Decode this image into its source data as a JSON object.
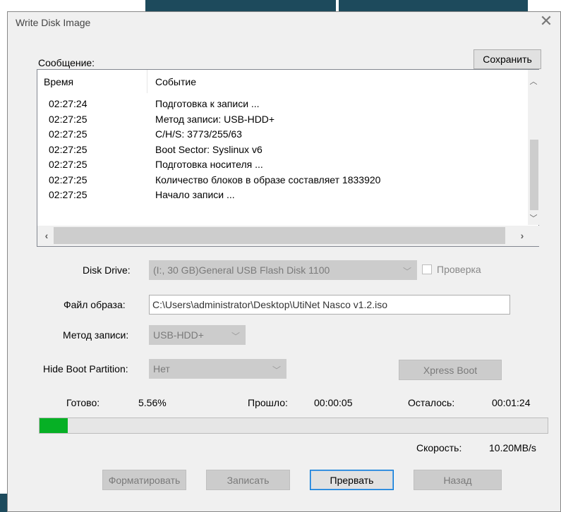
{
  "window": {
    "title": "Write Disk Image",
    "close_glyph": "✕"
  },
  "log": {
    "label": "Сообщение:",
    "save_label": "Сохранить",
    "columns": [
      "Время",
      "Событие"
    ],
    "rows": [
      {
        "time": "02:27:24",
        "event": "Подготовка к записи ..."
      },
      {
        "time": "02:27:25",
        "event": "Метод записи: USB-HDD+"
      },
      {
        "time": "02:27:25",
        "event": "C/H/S: 3773/255/63"
      },
      {
        "time": "02:27:25",
        "event": "Boot Sector: Syslinux v6"
      },
      {
        "time": "02:27:25",
        "event": "Подготовка носителя ..."
      },
      {
        "time": "02:27:25",
        "event": "Количество блоков в образе составляет 1833920"
      },
      {
        "time": "02:27:25",
        "event": "Начало записи ..."
      }
    ]
  },
  "form": {
    "disk_drive_label": "Disk Drive:",
    "disk_drive_value": "(I:, 30 GB)General USB Flash Disk  1100",
    "verify_label": "Проверка",
    "image_file_label": "Файл образа:",
    "image_file_value": "C:\\Users\\administrator\\Desktop\\UtiNet Nasco v1.2.iso",
    "write_method_label": "Метод записи:",
    "write_method_value": "USB-HDD+",
    "hide_boot_label": "Hide Boot Partition:",
    "hide_boot_value": "Нет",
    "xpress_boot_label": "Xpress Boot"
  },
  "status": {
    "done_label": "Готово:",
    "done_value": "5.56%",
    "elapsed_label": "Прошло:",
    "elapsed_value": "00:00:05",
    "remaining_label": "Осталось:",
    "remaining_value": "00:01:24",
    "speed_label": "Скорость:",
    "speed_value": "10.20MB/s",
    "progress_fraction": 0.0556
  },
  "buttons": {
    "format": "Форматировать",
    "write": "Записать",
    "abort": "Прервать",
    "back": "Назад"
  },
  "colors": {
    "progress_fill": "#06b025",
    "background_header": "#1d4a5c"
  }
}
